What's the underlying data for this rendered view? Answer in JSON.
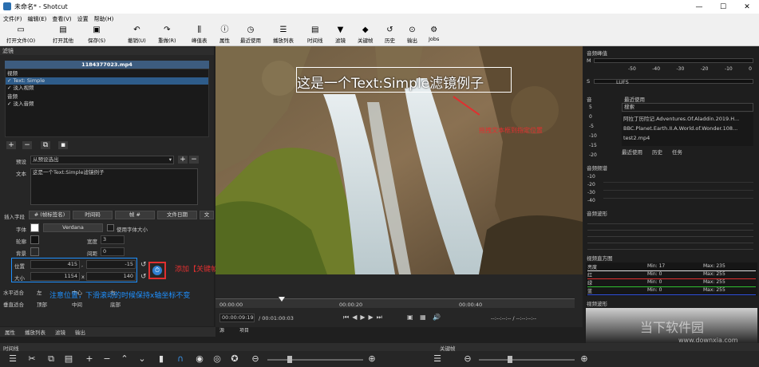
{
  "window": {
    "title": "未命名* - Shotcut",
    "min": "—",
    "max": "☐",
    "close": "✕"
  },
  "menu": [
    "文件(F)",
    "编辑(E)",
    "查看(V)",
    "设置",
    "帮助(H)"
  ],
  "toolbar": [
    {
      "label": "打开文件(O)",
      "icon": "folder-icon",
      "glyph": "▭"
    },
    {
      "label": "打开其他",
      "icon": "open-other-icon",
      "glyph": "▤"
    },
    {
      "label": "保存(S)",
      "icon": "save-icon",
      "glyph": "▣"
    },
    {
      "label": "撤销(U)",
      "icon": "undo-icon",
      "glyph": "↶"
    },
    {
      "label": "重做(R)",
      "icon": "redo-icon",
      "glyph": "↷"
    },
    {
      "label": "峰值表",
      "icon": "peak-meter-icon",
      "glyph": "⫼"
    },
    {
      "label": "属性",
      "icon": "properties-icon",
      "glyph": "ⓘ"
    },
    {
      "label": "最近使用",
      "icon": "recent-icon",
      "glyph": "◷"
    },
    {
      "label": "播放列表",
      "icon": "playlist-icon",
      "glyph": "☰"
    },
    {
      "label": "时间线",
      "icon": "timeline-icon",
      "glyph": "▤"
    },
    {
      "label": "滤镜",
      "icon": "filter-icon",
      "glyph": "▼"
    },
    {
      "label": "关键帧",
      "icon": "keyframe-icon",
      "glyph": "◆"
    },
    {
      "label": "历史",
      "icon": "history-icon",
      "glyph": "↺"
    },
    {
      "label": "输出",
      "icon": "export-icon",
      "glyph": "⊙"
    },
    {
      "label": "Jobs",
      "icon": "jobs-icon",
      "glyph": "⚙"
    }
  ],
  "filters": {
    "panel_title": "滤镜",
    "file_name": "1184377023.mp4",
    "groups": [
      {
        "label": "视频",
        "items": [
          {
            "label": "Text: Simple",
            "selected": true
          },
          {
            "label": "淡入视频",
            "selected": false
          }
        ]
      },
      {
        "label": "音频",
        "items": [
          {
            "label": "淡入音频",
            "selected": false
          }
        ]
      }
    ],
    "preset_label": "预设",
    "preset_value": "从预设选出",
    "text_label": "文本",
    "text_value": "这是一个Text:Simple滤镜例子",
    "insert_label": "插入字段",
    "insert_buttons": [
      "# (帧标签名)",
      "时间码",
      "帧 #",
      "文件日期",
      "文"
    ],
    "font_label": "字体",
    "font_name": "Verdana",
    "use_font_size": "使用字体大小",
    "outline_label": "轮廓",
    "thickness_label": "宽度",
    "thickness_value": "3",
    "bg_label": "背景",
    "padding_label": "间距",
    "padding_value": "0",
    "position_label": "位置",
    "position_x": "415",
    "position_y": "-15",
    "size_label": "大小",
    "size_w": "1154",
    "size_h": "140",
    "size_sep": "x",
    "halign_label": "水平适合",
    "halign_options": [
      "左",
      "中心",
      "右"
    ],
    "valign_label": "垂直适合",
    "valign_options": [
      "顶部",
      "中间",
      "底部"
    ]
  },
  "annotations": {
    "add_keyframe": "添加【关键帧】",
    "drag_text": "拖拽文本框到指定位置",
    "note": "注意位置，下滑滚动的时候保持x轴坐标不变"
  },
  "video": {
    "overlay_text": "这是一个Text:Simple滤镜例子"
  },
  "timebar": {
    "ticks": [
      "00:00:00",
      "00:00:20",
      "00:00:40"
    ],
    "current": "00:00:09:19",
    "total": "/ 00:01:00:03",
    "tabs": [
      "源",
      "项目"
    ],
    "timecode_placeholder": "--:--:--:-- / --:--:--:--"
  },
  "right": {
    "audio_peak": "音频峰值",
    "lufs": "LUFS",
    "peak_scale": [
      "-50",
      "-40",
      "-30",
      "-20",
      "-10",
      "0"
    ],
    "meter_l": "M",
    "meter_s": "S",
    "recent_title": "最近使用",
    "recent_search": "搜索",
    "recent_items": [
      "阿拉丁历险记.Adventures.Of.Aladdin.2019.H...",
      "BBC.Planet.Earth.II.A.World.of.Wonder.108...",
      "test2.mp4"
    ],
    "recent_tabs": [
      "最近使用",
      "历史",
      "任务"
    ],
    "audio_vol": "音",
    "vol_scale": [
      "5",
      "0",
      "-5",
      "-10",
      "-15",
      "-20"
    ],
    "spectrum_title": "音频频谱",
    "spectrum_scale": [
      "-10",
      "-20",
      "-30",
      "-40"
    ],
    "waveform_title": "音频波形",
    "histogram_title": "视频直方图",
    "histogram_rows": [
      {
        "name": "亮度",
        "min": "Min: 17",
        "max": "Max: 235",
        "color": "#e0e0e0"
      },
      {
        "name": "红",
        "min": "Min: 0",
        "max": "Max: 255",
        "color": "#e03030"
      },
      {
        "name": "绿",
        "min": "Min: 0",
        "max": "Max: 255",
        "color": "#30c030"
      },
      {
        "name": "蓝",
        "min": "Min: 0",
        "max": "Max: 255",
        "color": "#3050e0"
      }
    ],
    "vwave_title": "视频波形",
    "keyframes_label": "关键帧",
    "watermark": "当下软件园",
    "watermark_url": "www.downxia.com"
  },
  "bottom_tabs": [
    "属性",
    "播放列表",
    "滤镜",
    "输出"
  ],
  "timeline_title": "时间线",
  "colors": {
    "accent": "#2e5c8a",
    "highlight": "#1e90ff",
    "annotation": "#e03030"
  }
}
